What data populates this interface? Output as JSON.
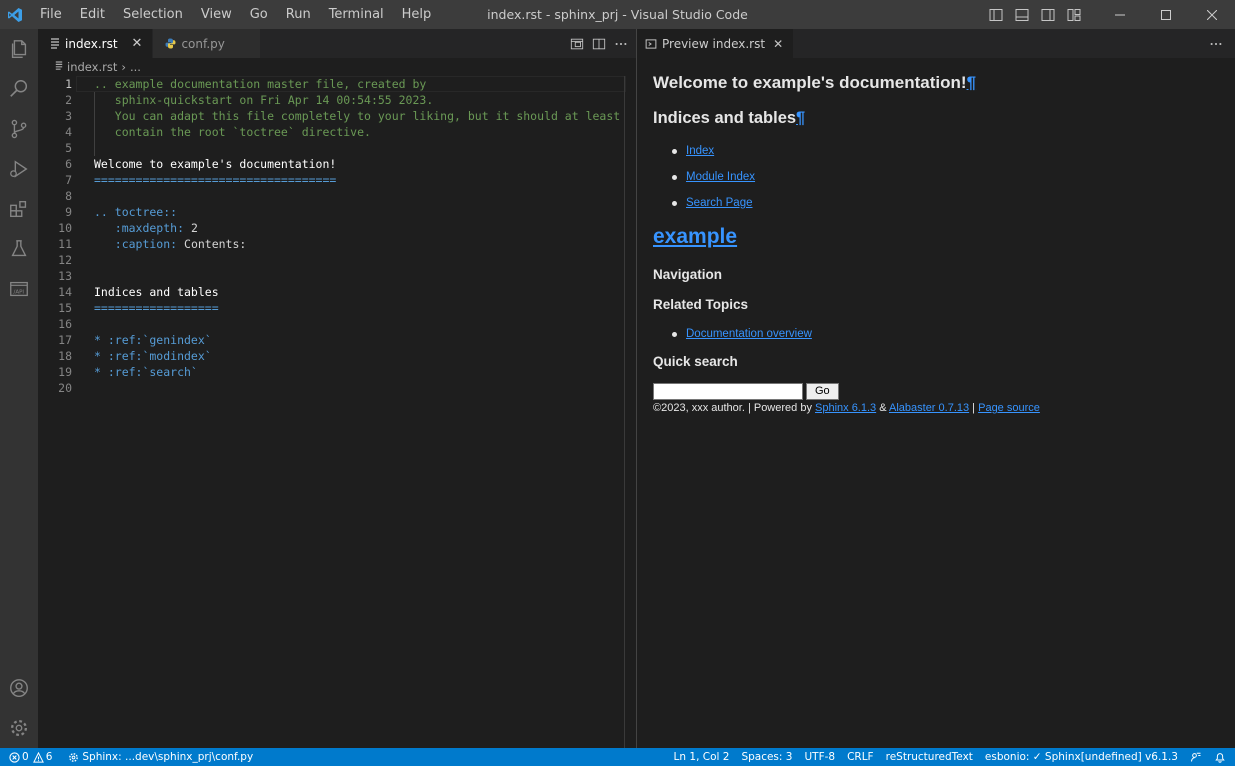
{
  "window": {
    "title": "index.rst - sphinx_prj - Visual Studio Code"
  },
  "menu": [
    "File",
    "Edit",
    "Selection",
    "View",
    "Go",
    "Run",
    "Terminal",
    "Help"
  ],
  "activity_icons": [
    "explorer-icon",
    "search-icon",
    "source-control-icon",
    "run-debug-icon",
    "extensions-icon",
    "testing-icon",
    "api-icon"
  ],
  "activity_bottom_icons": [
    "accounts-icon",
    "manage-gear-icon"
  ],
  "editor": {
    "tabs": [
      {
        "label": "index.rst",
        "active": true
      },
      {
        "label": "conf.py",
        "active": false
      }
    ],
    "breadcrumb": {
      "file": "index.rst",
      "rest": "..."
    },
    "lines": [
      {
        "n": "1",
        "parts": [
          {
            "c": "c-comment",
            "t": ".. example documentation master file, created by"
          }
        ]
      },
      {
        "n": "2",
        "parts": [
          {
            "c": "c-comment",
            "t": "   sphinx-quickstart on Fri Apr 14 00:54:55 2023."
          }
        ]
      },
      {
        "n": "3",
        "parts": [
          {
            "c": "c-comment",
            "t": "   You can adapt this file completely to your liking, but it should at least"
          }
        ]
      },
      {
        "n": "4",
        "parts": [
          {
            "c": "c-comment",
            "t": "   contain the root `toctree` directive."
          }
        ]
      },
      {
        "n": "5",
        "parts": []
      },
      {
        "n": "6",
        "parts": [
          {
            "c": "c-white",
            "t": "Welcome to example's documentation!"
          }
        ]
      },
      {
        "n": "7",
        "parts": [
          {
            "c": "c-blue",
            "t": "==================================="
          }
        ]
      },
      {
        "n": "8",
        "parts": []
      },
      {
        "n": "9",
        "parts": [
          {
            "c": "c-blue",
            "t": ".. toctree::"
          }
        ]
      },
      {
        "n": "10",
        "parts": [
          {
            "c": "c-blue",
            "t": "   :maxdepth:"
          },
          {
            "c": "c-text",
            "t": " 2"
          }
        ]
      },
      {
        "n": "11",
        "parts": [
          {
            "c": "c-blue",
            "t": "   :caption:"
          },
          {
            "c": "c-text",
            "t": " Contents:"
          }
        ]
      },
      {
        "n": "12",
        "parts": []
      },
      {
        "n": "13",
        "parts": []
      },
      {
        "n": "14",
        "parts": [
          {
            "c": "c-white",
            "t": "Indices and tables"
          }
        ]
      },
      {
        "n": "15",
        "parts": [
          {
            "c": "c-blue",
            "t": "=================="
          }
        ]
      },
      {
        "n": "16",
        "parts": []
      },
      {
        "n": "17",
        "parts": [
          {
            "c": "c-blue",
            "t": "* :ref:`genindex`"
          }
        ]
      },
      {
        "n": "18",
        "parts": [
          {
            "c": "c-blue",
            "t": "* :ref:`modindex`"
          }
        ]
      },
      {
        "n": "19",
        "parts": [
          {
            "c": "c-blue",
            "t": "* :ref:`search`"
          }
        ]
      },
      {
        "n": "20",
        "parts": []
      }
    ]
  },
  "preview": {
    "tab_label": "Preview index.rst",
    "h1": "Welcome to example's documentation!",
    "h2": "Indices and tables",
    "pilcrow": "¶",
    "index_links": [
      "Index",
      "Module Index",
      "Search Page"
    ],
    "brand": "example",
    "nav_heading": "Navigation",
    "related_heading": "Related Topics",
    "related_links": [
      "Documentation overview"
    ],
    "quick_search_heading": "Quick search",
    "go_button": "Go",
    "footer": {
      "copyright": "©2023, xxx author. | Powered by ",
      "sphinx_link": "Sphinx 6.1.3",
      "amp": " & ",
      "alabaster_link": "Alabaster 0.7.13",
      "sep": " | ",
      "source_link": "Page source"
    }
  },
  "status": {
    "errors": "0",
    "warnings": "6",
    "sphinx_conf": "Sphinx: ...dev\\sphinx_prj\\conf.py",
    "position": "Ln 1, Col 2",
    "spaces": "Spaces: 3",
    "encoding": "UTF-8",
    "eol": "CRLF",
    "language": "reStructuredText",
    "esbonio": "esbonio: ✓ Sphinx[undefined] v6.1.3"
  }
}
